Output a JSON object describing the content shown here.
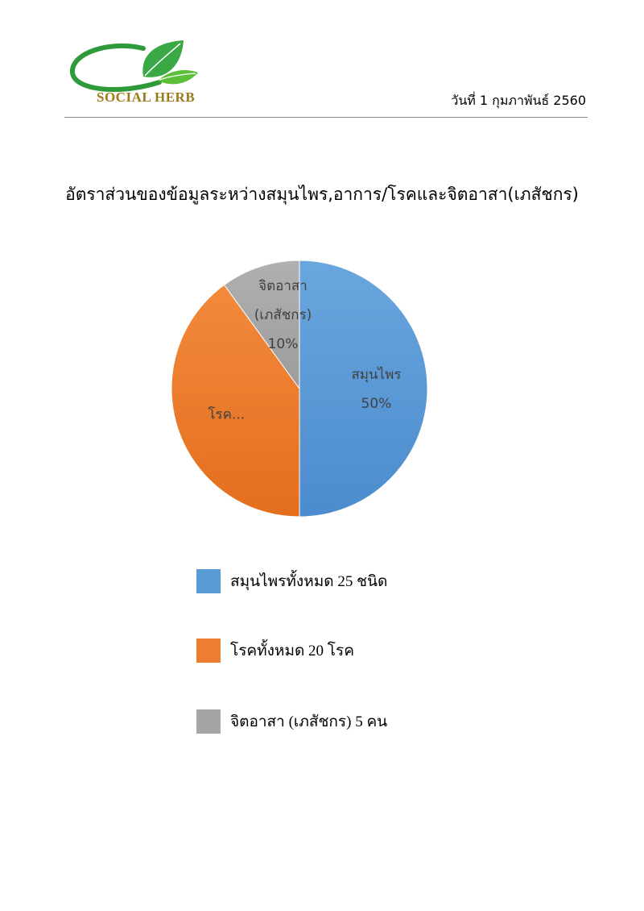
{
  "header": {
    "logo_text": "SOCIAL HERB",
    "date": "วันที่ 1 กุมภาพันธ์ 2560"
  },
  "colors": {
    "herb": "#5b9bd5",
    "disease": "#ed7d31",
    "practitioner": "#a5a5a5",
    "logo_green": "#2e9a3a",
    "logo_gold": "#9a7a1a"
  },
  "chart_data": {
    "type": "pie",
    "title": "อัตราส่วนของข้อมูลระหว่างสมุนไพร,อาการ/โรคและจิตอาสา(เภสัชกร)",
    "slices": [
      {
        "label": "สมุนไพร",
        "value": 50,
        "value_label": "50%"
      },
      {
        "label": "โรค...",
        "value": 40,
        "value_label": ""
      },
      {
        "label_lines": [
          "จิตอาสา",
          "(เภสัชกร)"
        ],
        "value": 10,
        "value_label": "10%"
      }
    ]
  },
  "legend": [
    {
      "label": "สมุนไพรทั้งหมด 25 ชนิด"
    },
    {
      "label": "โรคทั้งหมด 20 โรค"
    },
    {
      "label": "จิตอาสา (เภสัชกร) 5 คน"
    }
  ]
}
